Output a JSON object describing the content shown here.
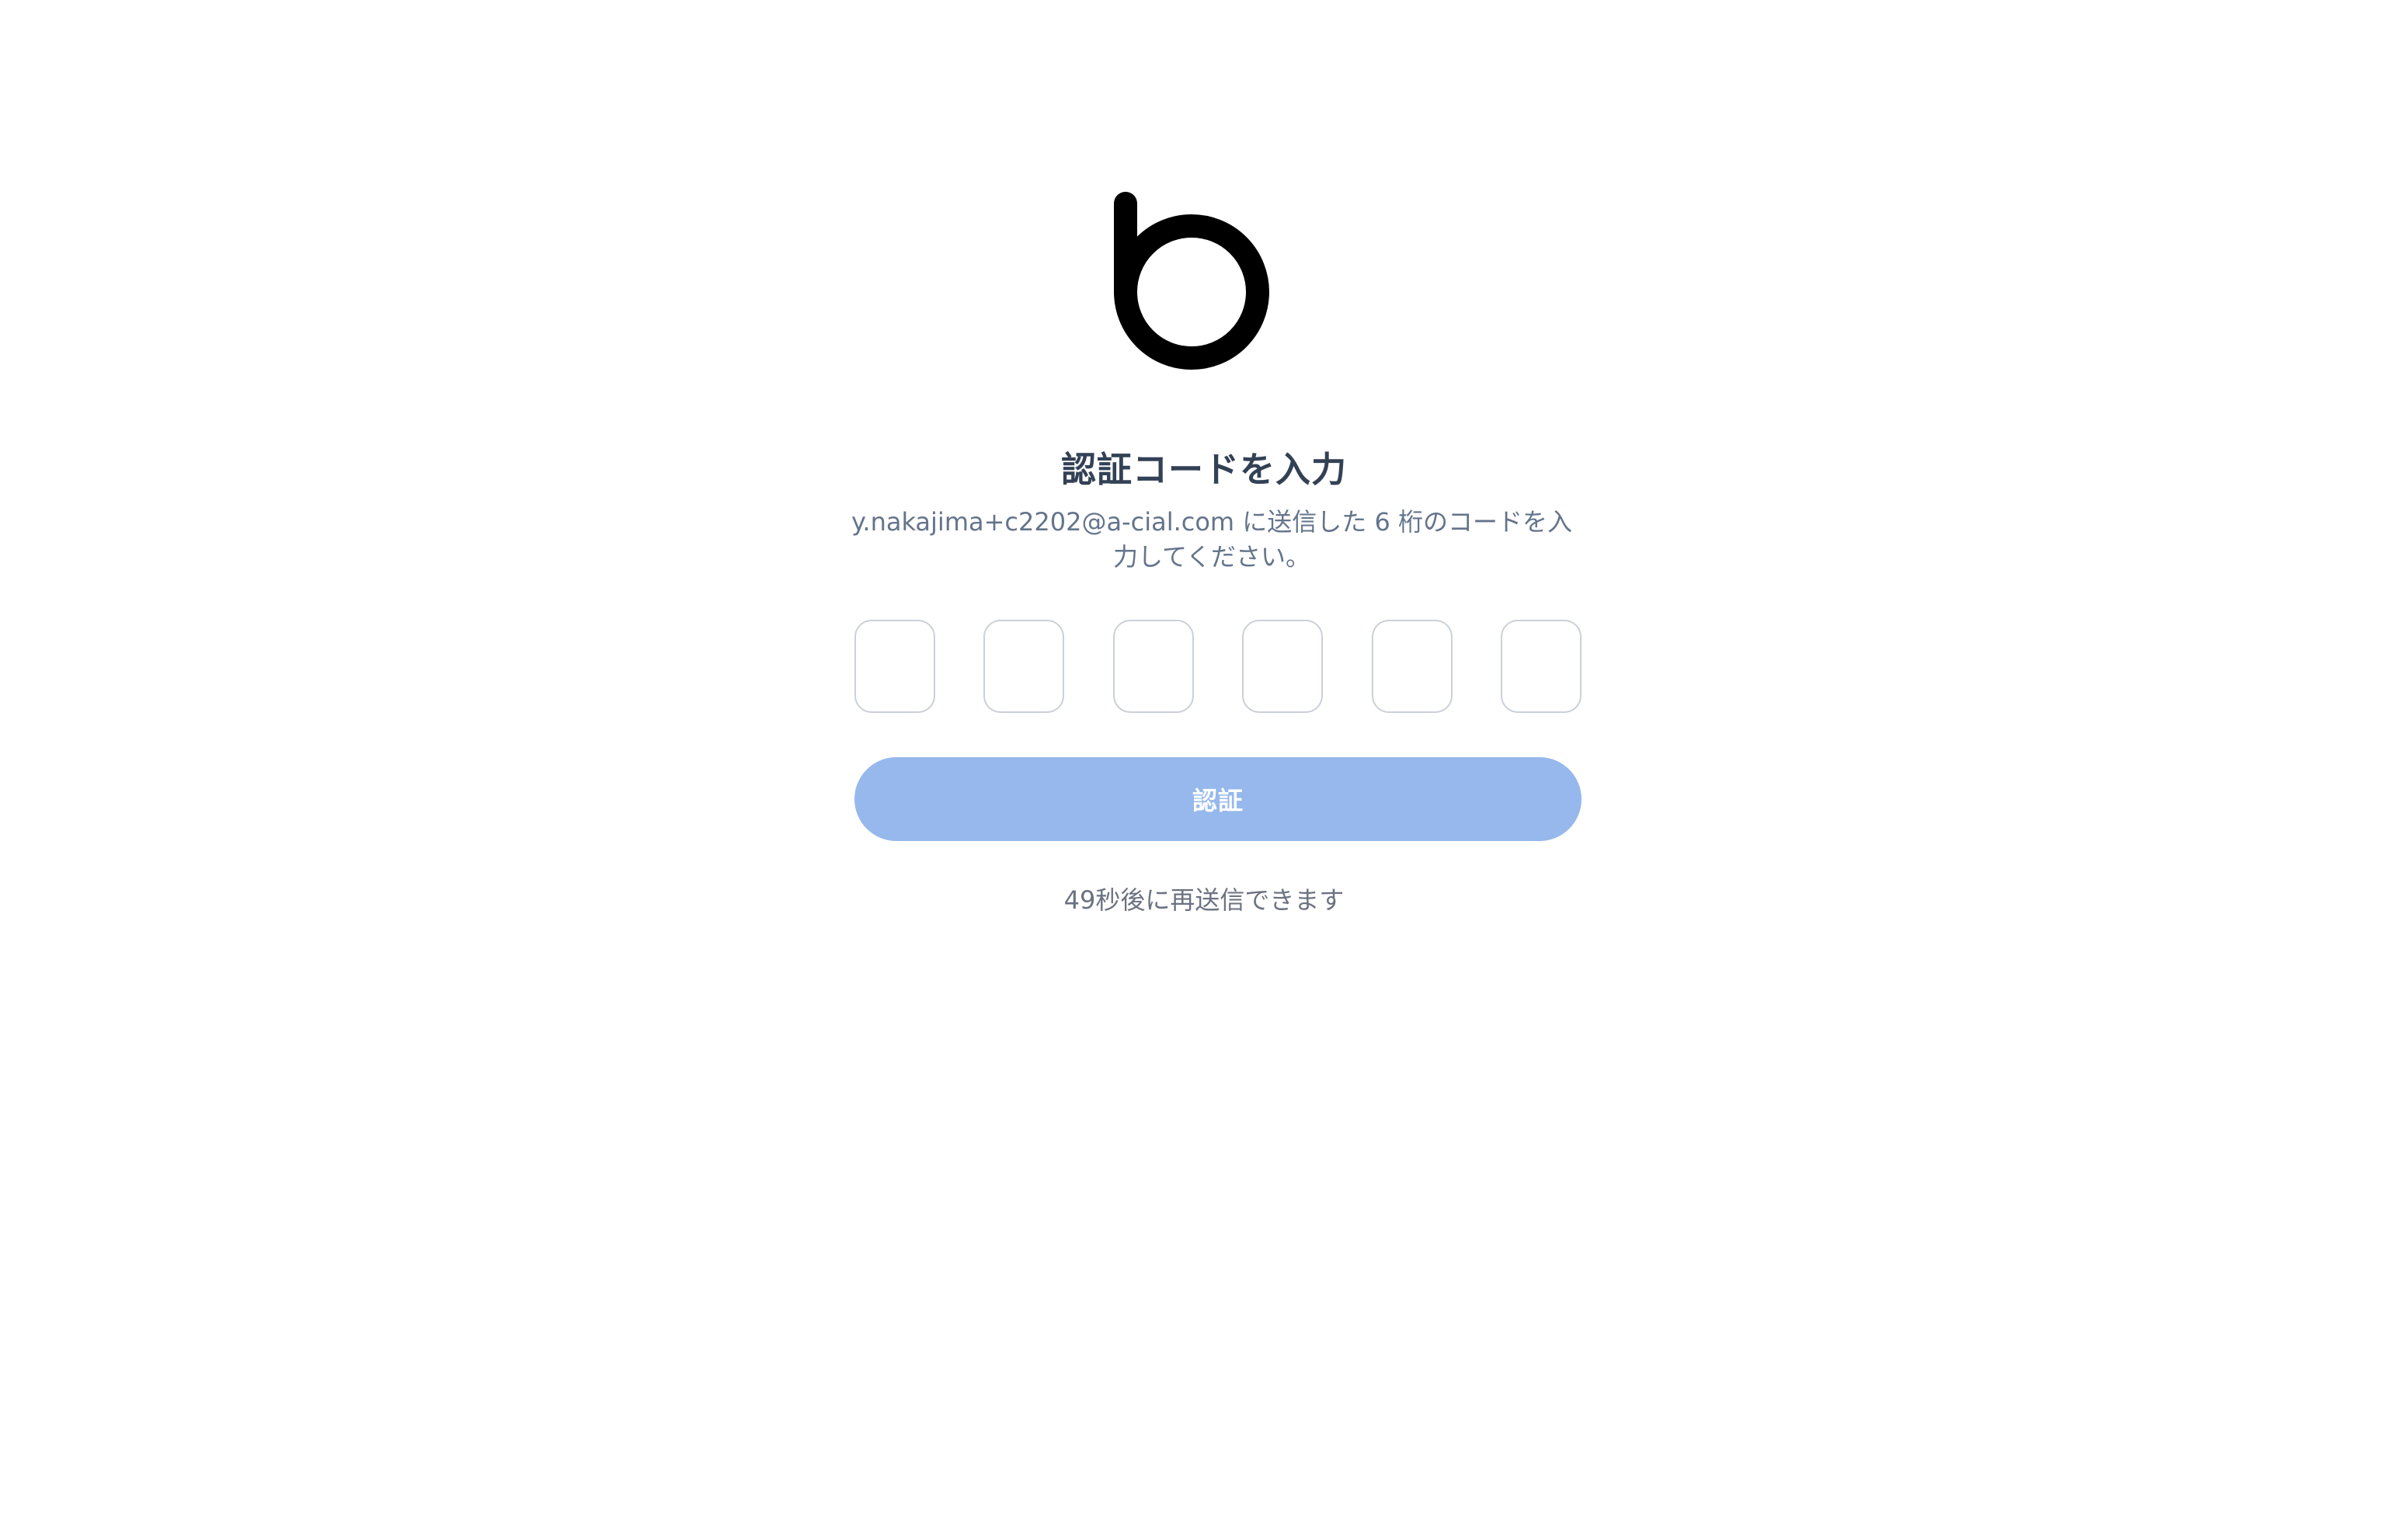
{
  "brand": {
    "logo_letter": "b",
    "logo_symbol": "+",
    "colors": {
      "letter": "#000000",
      "plus_start": "#1e7fe8",
      "plus_mid": "#4a2ad8",
      "plus_end": "#e8146e"
    }
  },
  "page": {
    "title": "認証コードを入力",
    "description": "y.nakajima+c2202@a-cial.com に送信した 6 桁のコードを入力してください。"
  },
  "otp": {
    "digit_count": 6,
    "values": [
      "",
      "",
      "",
      "",
      "",
      ""
    ]
  },
  "actions": {
    "verify_label": "認証",
    "verify_button_color": "#96b8ec",
    "resend_text": "49秒後に再送信できます"
  }
}
